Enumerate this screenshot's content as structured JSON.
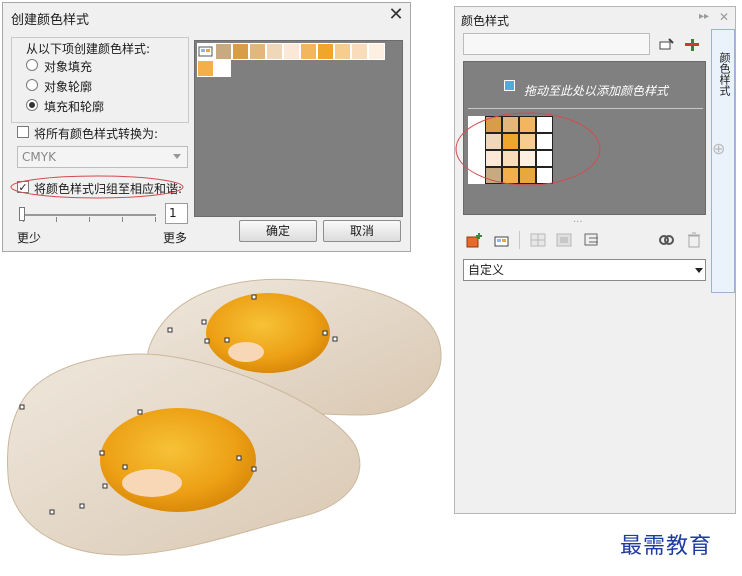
{
  "dialog": {
    "title": "创建颜色样式",
    "close_glyph": "✕",
    "group_label": "从以下项创建颜色样式:",
    "options": [
      {
        "label": "对象填充",
        "selected": false
      },
      {
        "label": "对象轮廓",
        "selected": false
      },
      {
        "label": "填充和轮廓",
        "selected": true
      }
    ],
    "convert_checkbox": {
      "label": "将所有颜色样式转换为:",
      "checked": false
    },
    "color_model": "CMYK",
    "group_checkbox": {
      "label": "将颜色样式归组至相应和谐:",
      "checked": true
    },
    "slider": {
      "value": "1",
      "min_label": "更少",
      "max_label": "更多"
    },
    "ok_label": "确定",
    "cancel_label": "取消",
    "swatches_row1": [
      "#c8aa80",
      "#d89d49",
      "#e3b77b",
      "#efd7b9",
      "#fbe8d6",
      "#f1b65e",
      "#f0a62a",
      "#f7cc90",
      "#f9ddbb",
      "#fdf0e2"
    ],
    "swatches_row2": [
      "#f3b04a",
      "#ffffff"
    ]
  },
  "docker": {
    "title": "颜色样式",
    "tab_label": "颜色样式",
    "drop_hint": "拖动至此处以添加颜色样式",
    "dropdown_value": "自定义",
    "harmony_rows": [
      [
        "#d89d49",
        "#e3b77b",
        "#f1b65e",
        "#ffffff"
      ],
      [
        "#efd7b9",
        "#f0a62a",
        "#f7cc90",
        "#ffffff"
      ],
      [
        "#fbe8d6",
        "#f9ddbb",
        "#fdf0e2",
        "#ffffff"
      ],
      [
        "#c8aa80",
        "#f3b04a",
        "#e8a83a",
        "#ffffff"
      ]
    ],
    "accent_color": "#e86a2a"
  },
  "watermark": "最需教育"
}
